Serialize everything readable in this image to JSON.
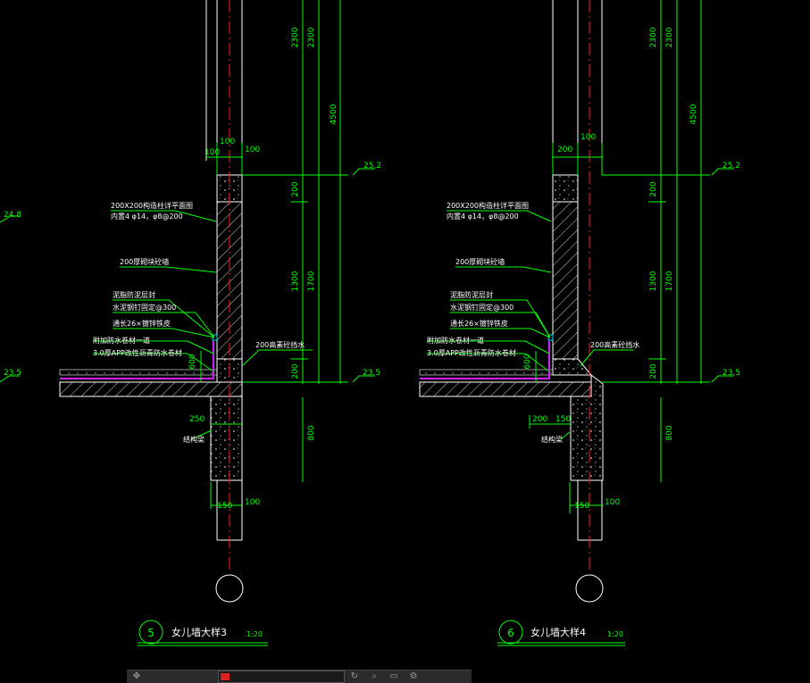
{
  "colors": {
    "dim": "#00ff00",
    "outline": "#ffffff",
    "label": "#ffffff",
    "center": "#ff2020",
    "membrane": "#d020ff",
    "cyan": "#00e0ff"
  },
  "details": [
    {
      "number": "5",
      "title": "女儿墙大样3",
      "scale": "1:20",
      "dims": {
        "d2300a": "2300",
        "d2300b": "2300",
        "d4500": "4500",
        "d100a": "100",
        "d100b": "100",
        "d100c": "100",
        "d200a": "200",
        "d1300": "1300",
        "d1700": "1700",
        "d200b": "200",
        "d600": "600",
        "d250": "250",
        "d800": "800",
        "d150": "150",
        "d100d": "100"
      },
      "levels": {
        "top": "25.2",
        "left": "24.8",
        "mid": "23.5",
        "right": "23.5"
      },
      "notes": [
        "200X200构造柱详平面图",
        "内置4 φ14，φ8@200",
        "200厚砌块砼墙",
        "泥脂防泥层封",
        "水泥钢钉固定@300",
        "通长26×镀锌铁皮",
        "附加防水卷材一道",
        "3.0厚APP改性沥青防水卷材",
        "200高素砼挡水",
        "结构梁"
      ]
    },
    {
      "number": "6",
      "title": "女儿墙大样4",
      "scale": "1:20",
      "dims": {
        "d2300a": "2300",
        "d2300b": "2300",
        "d4500": "4500",
        "d200a": "200",
        "d100a": "100",
        "d200b": "200",
        "d1300": "1300",
        "d1700": "1700",
        "d200c": "200",
        "d600": "600",
        "d200d": "200",
        "d150a": "150",
        "d800": "800",
        "d150b": "150",
        "d100b": "100"
      },
      "levels": {
        "top": "25.2",
        "mid": "23.5",
        "right": "23.5"
      },
      "notes": [
        "200X200构造柱详平面图",
        "内置4 φ14，φ8@200",
        "200厚砌块砼墙",
        "泥脂防泥层封",
        "水泥钢钉固定@300",
        "通长26×镀锌铁皮",
        "附加防水卷材一道",
        "3.0厚APP改性沥青防水卷材",
        "200高素砼挡水",
        "结构梁"
      ]
    }
  ],
  "toolbar": {
    "icons": [
      "pan-icon",
      "layer-icon",
      "rotate-icon",
      "zoom-icon",
      "print-icon",
      "settings-icon"
    ]
  }
}
